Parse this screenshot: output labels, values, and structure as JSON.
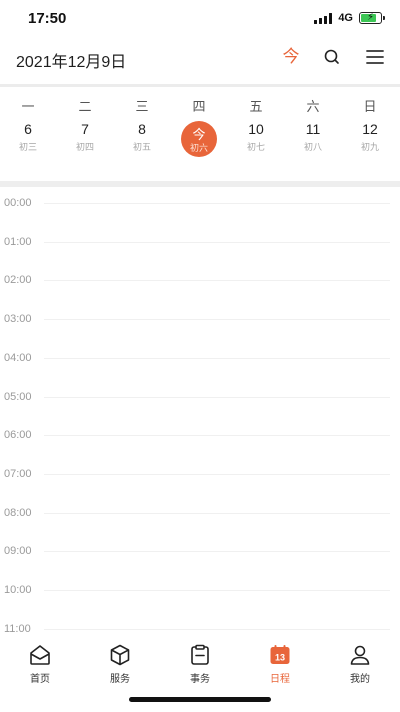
{
  "status_bar": {
    "time": "17:50",
    "network": "4G",
    "battery_level": 0.8
  },
  "header": {
    "title": "2021年12月9日",
    "today_label": "今",
    "icons": {
      "search": "search-icon",
      "menu": "menu-icon"
    }
  },
  "week": {
    "days": [
      {
        "weekday": "一",
        "date": "6",
        "lunar": "初三"
      },
      {
        "weekday": "二",
        "date": "7",
        "lunar": "初四"
      },
      {
        "weekday": "三",
        "date": "8",
        "lunar": "初五"
      },
      {
        "weekday": "四",
        "date": "今",
        "lunar": "初六",
        "selected": true
      },
      {
        "weekday": "五",
        "date": "10",
        "lunar": "初七"
      },
      {
        "weekday": "六",
        "date": "11",
        "lunar": "初八"
      },
      {
        "weekday": "日",
        "date": "12",
        "lunar": "初九"
      }
    ]
  },
  "timeline": {
    "hours": [
      "00:00",
      "01:00",
      "02:00",
      "03:00",
      "04:00",
      "05:00",
      "06:00",
      "07:00",
      "08:00",
      "09:00",
      "10:00",
      "11:00"
    ]
  },
  "tabbar": {
    "tabs": [
      {
        "label": "首页",
        "icon": "home-icon"
      },
      {
        "label": "服务",
        "icon": "cube-icon"
      },
      {
        "label": "事务",
        "icon": "clipboard-icon"
      },
      {
        "label": "日程",
        "icon": "calendar-icon",
        "active": true
      },
      {
        "label": "我的",
        "icon": "user-icon"
      }
    ]
  },
  "colors": {
    "accent": "#e8653a",
    "battery": "#3cc655"
  }
}
